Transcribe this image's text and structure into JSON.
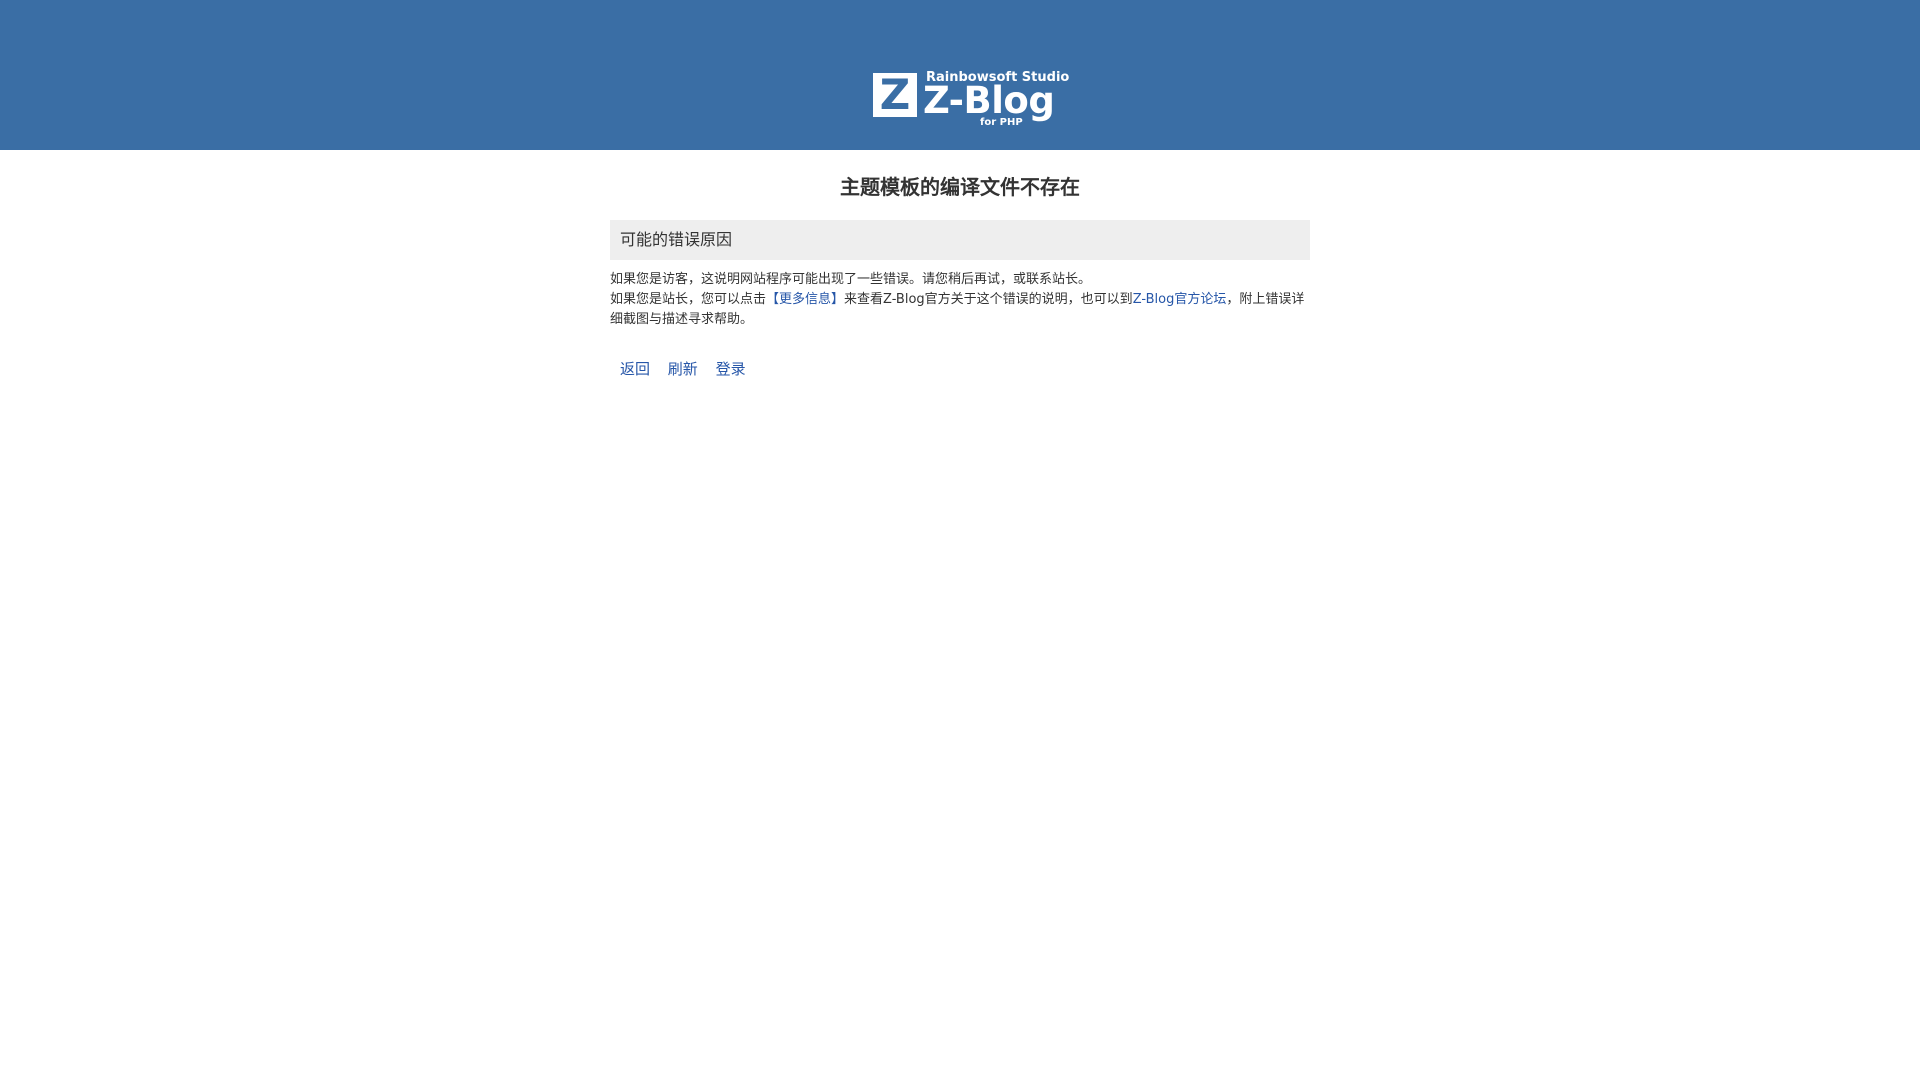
{
  "header": {
    "logo": {
      "mark": "Z",
      "top_text": "Rainbowsoft Studio",
      "main_text": "Z-Blog",
      "sub_text": "for PHP"
    },
    "background_color": "#3a6ea5"
  },
  "error": {
    "title": "主题模板的编译文件不存在",
    "reason_heading": "可能的错误原因",
    "line1": "如果您是访客，这说明网站程序可能出现了一些错误。请您稍后再试，或联系站长。",
    "line2_part1": "如果您是站长，您可以点击",
    "more_info_link": "【更多信息】",
    "line2_part2": "来查看Z-Blog官方关于这个错误的说明，也可以到",
    "forum_link": "Z-Blog官方论坛",
    "line2_part3": "，附上错误详细截图与描述寻求帮助。"
  },
  "actions": {
    "back": "返回",
    "refresh": "刷新",
    "login": "登录"
  },
  "link_color": "#2656a8"
}
